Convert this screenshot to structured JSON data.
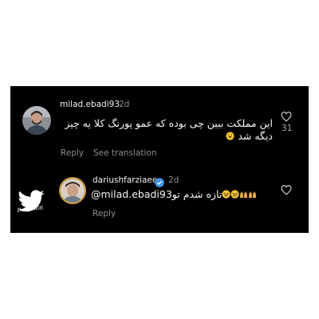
{
  "comment1": {
    "username": "milad.ebadi93",
    "time": "2d",
    "text_line1": "این مملکت ببین چی بوده که عمو پورنگ کلا یه چیز",
    "text_line2": "دیگه شد",
    "reply_label": "Reply",
    "translation_label": "See translation",
    "like_count": "31"
  },
  "comment2": {
    "username": "dariushfarziaee",
    "time": "2d",
    "mention": "@milad.ebadi93",
    "text": "تازه شدم تو",
    "reply_label": "Reply"
  },
  "watermark": {
    "text": "DarkTwitt"
  }
}
